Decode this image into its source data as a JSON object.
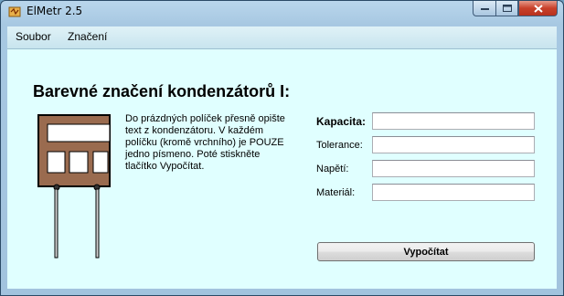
{
  "window": {
    "title": "ElMetr 2.5"
  },
  "menu": {
    "items": [
      "Soubor",
      "Značení"
    ]
  },
  "main": {
    "heading": "Barevné značení kondenzátorů I:",
    "instructions": "Do prázdných políček přesně opište text z kondenzátoru. V každém políčku (kromě vrchního) je POUZE jedno písmeno. Poté stiskněte tlačítko Vypočítat.",
    "fields": [
      {
        "label": "Kapacita:",
        "value": "",
        "bold": true
      },
      {
        "label": "Tolerance:",
        "value": ""
      },
      {
        "label": "Napětí:",
        "value": ""
      },
      {
        "label": "Materiál:",
        "value": ""
      }
    ],
    "calculate_label": "Vypočítat"
  },
  "colors": {
    "capacitor_body": "#9a6b4f",
    "client_bg": "#e0ffff"
  }
}
